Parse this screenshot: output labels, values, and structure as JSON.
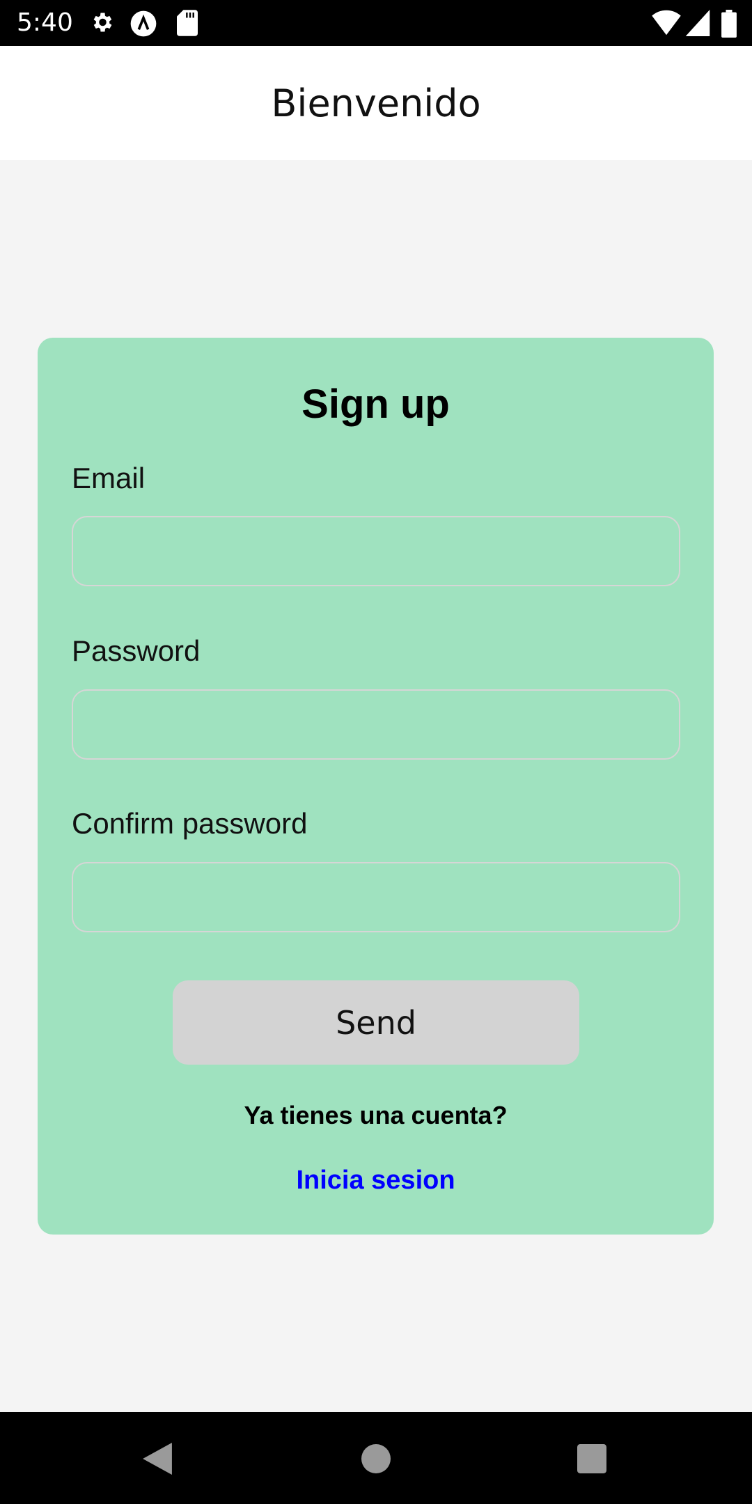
{
  "status_bar": {
    "time": "5:40",
    "icons": [
      "gear-icon",
      "app-notification-icon",
      "sd-card-icon",
      "wifi-icon",
      "signal-icon",
      "battery-icon"
    ]
  },
  "header": {
    "title": "Bienvenido"
  },
  "form": {
    "title": "Sign up",
    "fields": [
      {
        "label": "Email",
        "value": "",
        "placeholder": ""
      },
      {
        "label": "Password",
        "value": "",
        "placeholder": ""
      },
      {
        "label": "Confirm password",
        "value": "",
        "placeholder": ""
      }
    ],
    "send_label": "Send",
    "question": "Ya tienes una cuenta?",
    "login_link": "Inicia sesion"
  },
  "colors": {
    "card": "#9fe2bf",
    "button": "#d3d3d3",
    "link": "#0000ff",
    "background": "#f4f4f4"
  },
  "nav_bar": {
    "icons": [
      "back-icon",
      "home-icon",
      "recents-icon"
    ]
  }
}
